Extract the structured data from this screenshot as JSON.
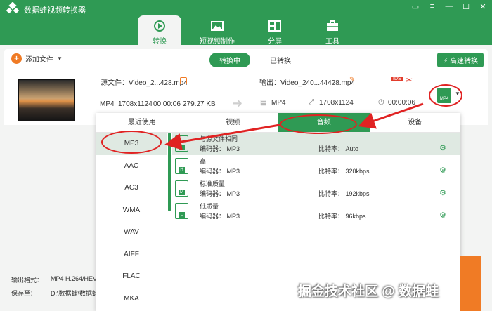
{
  "app": {
    "title": "数据蛙视频转换器"
  },
  "nav": {
    "items": [
      {
        "label": "转换",
        "icon": "convert-icon"
      },
      {
        "label": "短视频制作",
        "icon": "image-icon"
      },
      {
        "label": "分屏",
        "icon": "split-screen-icon"
      },
      {
        "label": "工具",
        "icon": "toolbox-icon"
      }
    ]
  },
  "toolbar": {
    "add_label": "添加文件",
    "tab_converting": "转换中",
    "tab_converted": "已转换",
    "hs_label": "高速转换"
  },
  "file": {
    "source_label": "源文件：Video_2...428.mp4",
    "output_label": "输出：Video_240...44428.mp4",
    "src_format": "MP4",
    "src_resolution": "1708x1124",
    "src_duration": "00:00:06",
    "src_size": "279.27 KB",
    "out_format": "MP4",
    "out_resolution": "1708x1124",
    "out_duration": "00:00:06",
    "badge_ids": "IDS",
    "fmt_badge": "MP4"
  },
  "popup": {
    "tabs": [
      "最近使用",
      "视频",
      "音频",
      "设备"
    ],
    "formats": [
      "MP3",
      "AAC",
      "AC3",
      "WMA",
      "WAV",
      "AIFF",
      "FLAC",
      "MKA"
    ],
    "qualities": [
      {
        "name": "与源文件相同",
        "encoder": "编码器：  MP3",
        "bitrate": "比特率：  Auto",
        "badge": ""
      },
      {
        "name": "高",
        "encoder": "编码器：  MP3",
        "bitrate": "比特率：  320kbps",
        "badge": "H"
      },
      {
        "name": "标准质量",
        "encoder": "编码器：  MP3",
        "bitrate": "比特率：  192kbps",
        "badge": "M"
      },
      {
        "name": "低质量",
        "encoder": "编码器：  MP3",
        "bitrate": "比特率：  96kbps",
        "badge": "L"
      }
    ]
  },
  "bottom": {
    "out_format_label": "输出格式：",
    "out_format_value": "MP4 H.264/HEV",
    "save_label": "保存至：",
    "save_value": "D:\\数据蛙\\数据蛙"
  },
  "watermark": "掘金技术社区 @ 数据蛙"
}
